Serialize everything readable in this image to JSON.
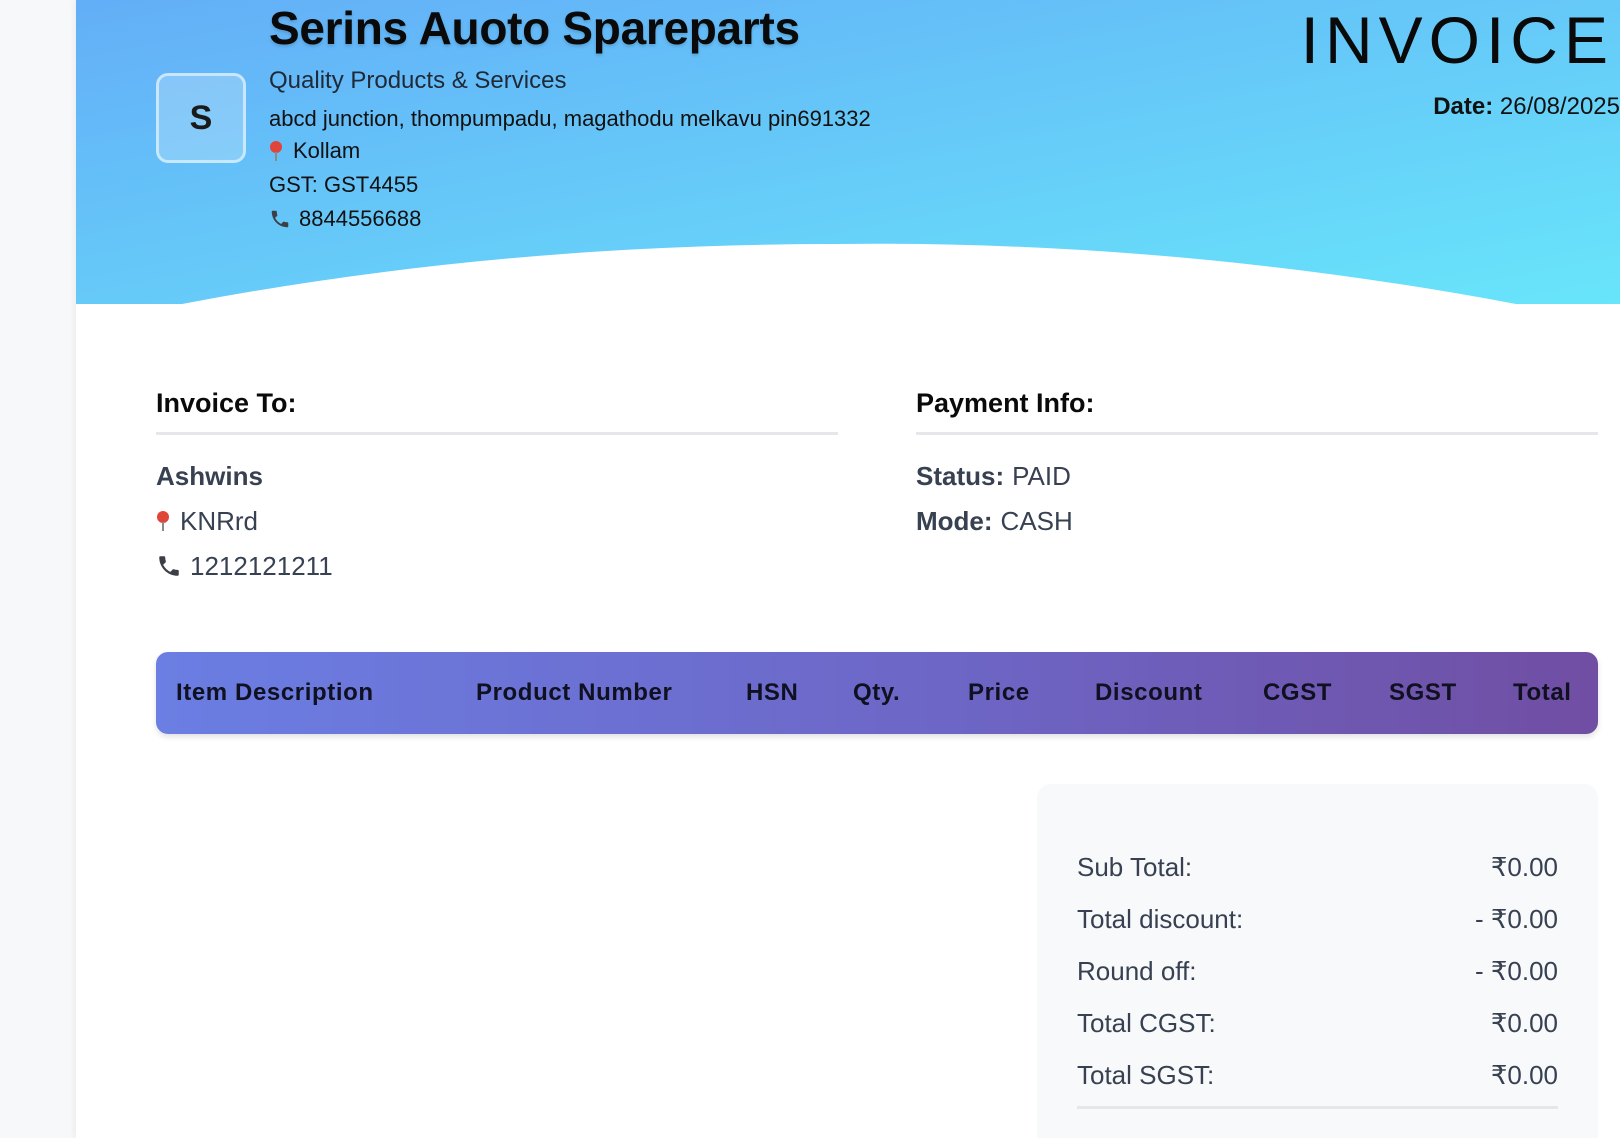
{
  "company": {
    "logo_letter": "S",
    "name": "Serins Auoto Spareparts",
    "tagline": "Quality Products & Services",
    "address": "abcd junction, thompumpadu, magathodu melkavu pin691332",
    "city": "Kollam",
    "gst": "GST: GST4455",
    "phone": "8844556688"
  },
  "invoice": {
    "title": "INVOICE",
    "date_label": "Date:",
    "date_value": "26/08/2025"
  },
  "invoice_to": {
    "heading": "Invoice To:",
    "name": "Ashwins",
    "address": "KNRrd",
    "phone": "1212121211"
  },
  "payment": {
    "heading": "Payment Info:",
    "status_label": "Status:",
    "status_value": "PAID",
    "mode_label": "Mode:",
    "mode_value": "CASH"
  },
  "table": {
    "columns": [
      "Item Description",
      "Product Number",
      "HSN",
      "Qty.",
      "Price",
      "Discount",
      "CGST",
      "SGST",
      "Total"
    ]
  },
  "summary": {
    "rows": [
      {
        "label": "Sub Total:",
        "value": "₹0.00"
      },
      {
        "label": "Total discount:",
        "value": "- ₹0.00"
      },
      {
        "label": "Round off:",
        "value": "- ₹0.00"
      },
      {
        "label": "Total CGST:",
        "value": "₹0.00"
      },
      {
        "label": "Total SGST:",
        "value": "₹0.00"
      }
    ]
  },
  "colors": {
    "header_gradient_start": "#63aef7",
    "header_gradient_end": "#68e5fa",
    "table_gradient_start": "#6b7ee3",
    "table_gradient_end": "#704ea3",
    "pin_icon": "#e0453a"
  },
  "icons": [
    "location-pin-icon",
    "phone-icon"
  ]
}
